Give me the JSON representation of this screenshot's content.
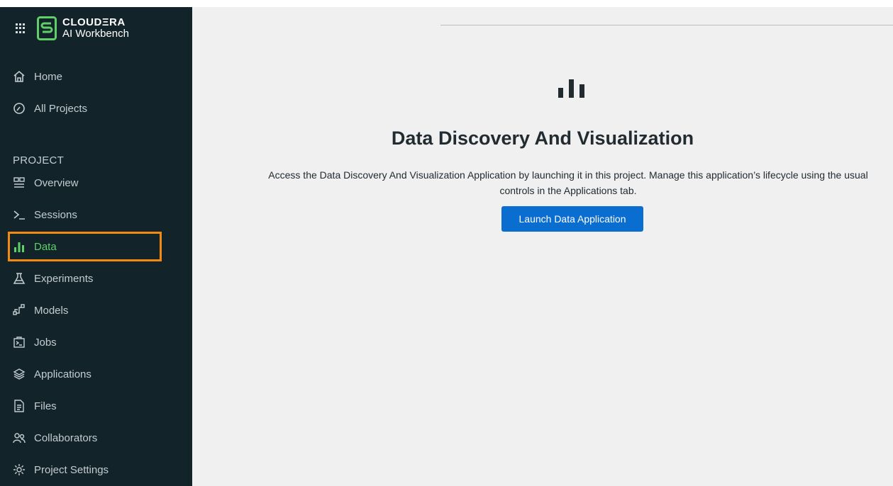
{
  "brand": {
    "name": "CLOUDΞRA",
    "product": "AI Workbench"
  },
  "sidebar": {
    "top_items": [
      {
        "label": "Home",
        "icon": "home-icon"
      },
      {
        "label": "All Projects",
        "icon": "gauge-icon"
      }
    ],
    "section_label": "PROJECT",
    "project_items": [
      {
        "label": "Overview",
        "icon": "overview-icon"
      },
      {
        "label": "Sessions",
        "icon": "terminal-icon"
      },
      {
        "label": "Data",
        "icon": "bar-chart-icon",
        "active": true
      },
      {
        "label": "Experiments",
        "icon": "flask-icon"
      },
      {
        "label": "Models",
        "icon": "models-icon"
      },
      {
        "label": "Jobs",
        "icon": "jobs-icon"
      },
      {
        "label": "Applications",
        "icon": "layers-icon"
      },
      {
        "label": "Files",
        "icon": "file-icon"
      },
      {
        "label": "Collaborators",
        "icon": "people-icon"
      },
      {
        "label": "Project Settings",
        "icon": "gear-icon"
      }
    ]
  },
  "main": {
    "hero_icon": "bar-chart-icon",
    "title": "Data Discovery And Visualization",
    "description": "Access the Data Discovery And Visualization Application by launching it in this project. Manage this application’s lifecycle using the usual controls in the Applications tab.",
    "launch_button": "Launch Data Application"
  },
  "colors": {
    "sidebar_bg": "#13232a",
    "active_green": "#5fd068",
    "highlight_orange": "#f4890f",
    "primary_blue": "#0a6ed1",
    "main_bg": "#f0f0f0"
  }
}
